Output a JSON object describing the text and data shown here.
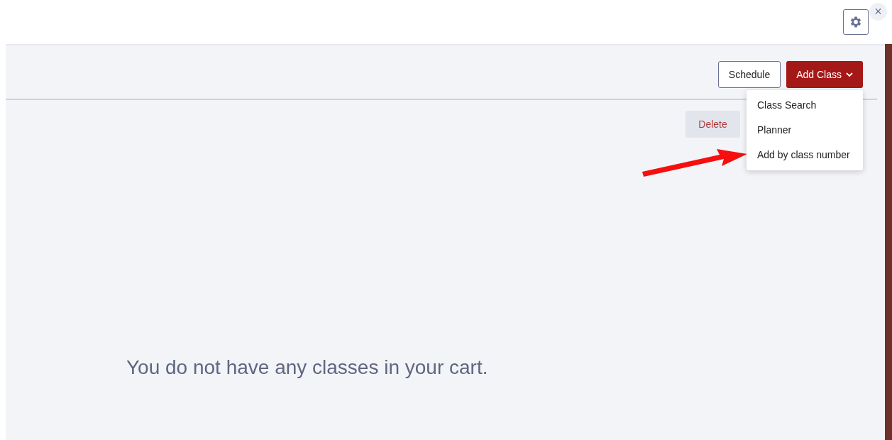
{
  "close_button": {
    "label": "×"
  },
  "toolbar": {
    "schedule_button": {
      "label": "Schedule"
    },
    "add_class_button": {
      "label": "Add Class",
      "expanded": true
    }
  },
  "add_class_menu": {
    "items": [
      {
        "label": "Class Search"
      },
      {
        "label": "Planner"
      },
      {
        "label": "Add by class number"
      }
    ]
  },
  "delete_button": {
    "label": "Delete"
  },
  "empty_message": "You do not have any classes in your cart."
}
